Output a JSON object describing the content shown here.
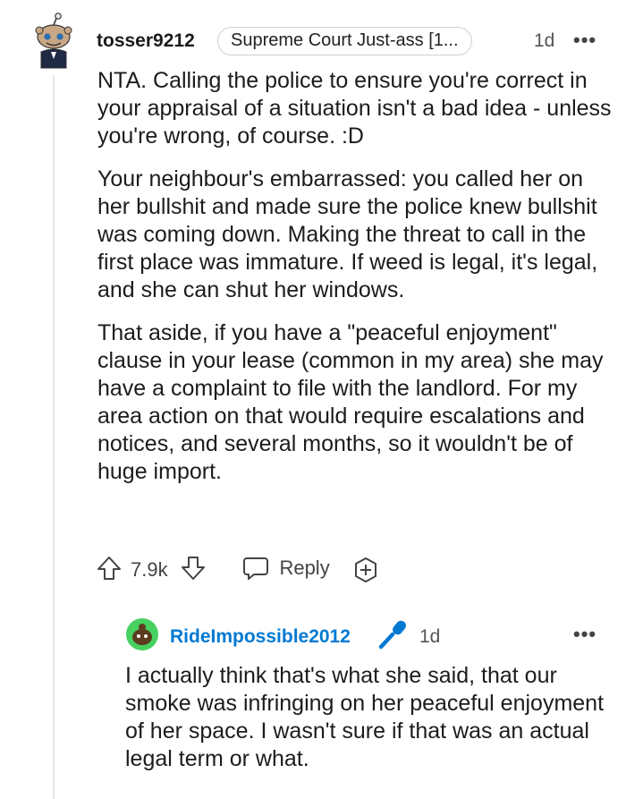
{
  "comment": {
    "username": "tosser9212",
    "flair": "Supreme Court Just-ass [1...",
    "age": "1d",
    "more": "•••",
    "paragraphs": [
      "NTA. Calling the police to ensure you're correct in your appraisal of a situation isn't a bad idea - unless you're wrong, of course. :D",
      "Your neighbour's embarrassed: you called her on her bullshit and made sure the police knew bullshit was coming down. Making the threat to call in the first place was immature. If weed is legal, it's legal, and she can shut her windows.",
      "That aside, if you have a \"peaceful enjoyment\" clause in your lease (common in my area) she may have a complaint to file with the landlord. For my area action on that would require escalations and notices, and several months, so it wouldn't be of huge import."
    ],
    "vote_count": "7.9k",
    "reply_label": "Reply"
  },
  "reply": {
    "username": "RideImpossible2012",
    "age": "1d",
    "more": "•••",
    "text": "I actually think that's what she said, that our smoke was infringing on her peaceful enjoyment of her space. I wasn't sure if that was an actual legal term or what."
  },
  "colors": {
    "reply_username": "#0079d3",
    "mic_icon": "#0079d3",
    "avatar_green": "#46d160"
  },
  "icons": [
    "snoo-avatar-icon",
    "upvote-icon",
    "downvote-icon",
    "reply-bubble-icon",
    "award-plus-icon",
    "green-avatar-icon",
    "microphone-icon",
    "more-icon"
  ]
}
